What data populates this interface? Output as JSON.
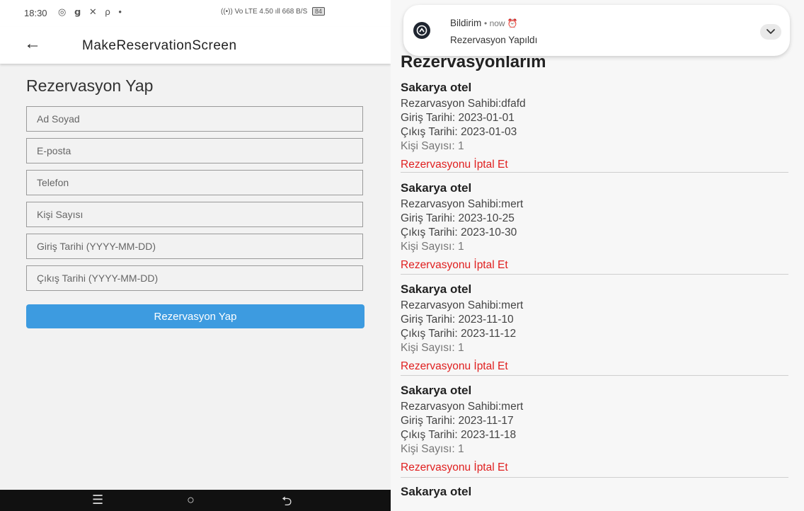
{
  "left_screen": {
    "status_bar": {
      "time": "18:30",
      "icons": "◎ 𝗴 ✕ ρ •",
      "right_icons": "((•)) Vo LTE 4.50 ıll 668 B/S",
      "battery": "84"
    },
    "app_bar": {
      "title": "MakeReservationScreen"
    },
    "form": {
      "heading": "Rezervasyon Yap",
      "fields": [
        {
          "placeholder": "Ad Soyad"
        },
        {
          "placeholder": "E-posta"
        },
        {
          "placeholder": "Telefon"
        },
        {
          "placeholder": "Kişi Sayısı"
        },
        {
          "placeholder": "Giriş Tarihi (YYYY-MM-DD)"
        },
        {
          "placeholder": "Çıkış Tarihi (YYYY-MM-DD)"
        }
      ],
      "submit_label": "Rezervasyon Yap"
    },
    "nav_bar": {
      "menu_icon": "☰",
      "home_icon": "○",
      "back_icon": "⮌"
    }
  },
  "right_screen": {
    "notification": {
      "app_name": "Bildirim",
      "meta": "• now ⏰",
      "text": "Rezervasyon Yapıldı"
    },
    "list_heading": "Rezervasyonlarım",
    "reservations": [
      {
        "hotel": "Sakarya otel",
        "owner": "Rezarvasyon Sahibi:dfafd",
        "checkin": "Giriş Tarihi: 2023-01-01",
        "checkout": "Çıkış Tarihi: 2023-01-03",
        "guests": "Kişi Sayısı: 1",
        "cancel": "Rezervasyonu İptal Et"
      },
      {
        "hotel": "Sakarya otel",
        "owner": "Rezarvasyon Sahibi:mert",
        "checkin": "Giriş Tarihi: 2023-10-25",
        "checkout": "Çıkış Tarihi: 2023-10-30",
        "guests": "Kişi Sayısı: 1",
        "cancel": "Rezervasyonu İptal Et"
      },
      {
        "hotel": "Sakarya otel",
        "owner": "Rezarvasyon Sahibi:mert",
        "checkin": "Giriş Tarihi: 2023-11-10",
        "checkout": "Çıkış Tarihi: 2023-11-12",
        "guests": "Kişi Sayısı: 1",
        "cancel": "Rezervasyonu İptal Et"
      },
      {
        "hotel": "Sakarya otel",
        "owner": "Rezarvasyon Sahibi:mert",
        "checkin": "Giriş Tarihi: 2023-11-17",
        "checkout": "Çıkış Tarihi: 2023-11-18",
        "guests": "Kişi Sayısı: 1",
        "cancel": "Rezervasyonu İptal Et"
      },
      {
        "hotel": "Sakarya otel"
      }
    ]
  },
  "colors": {
    "accent_button": "#3d9be0",
    "cancel_text": "#e02020"
  }
}
